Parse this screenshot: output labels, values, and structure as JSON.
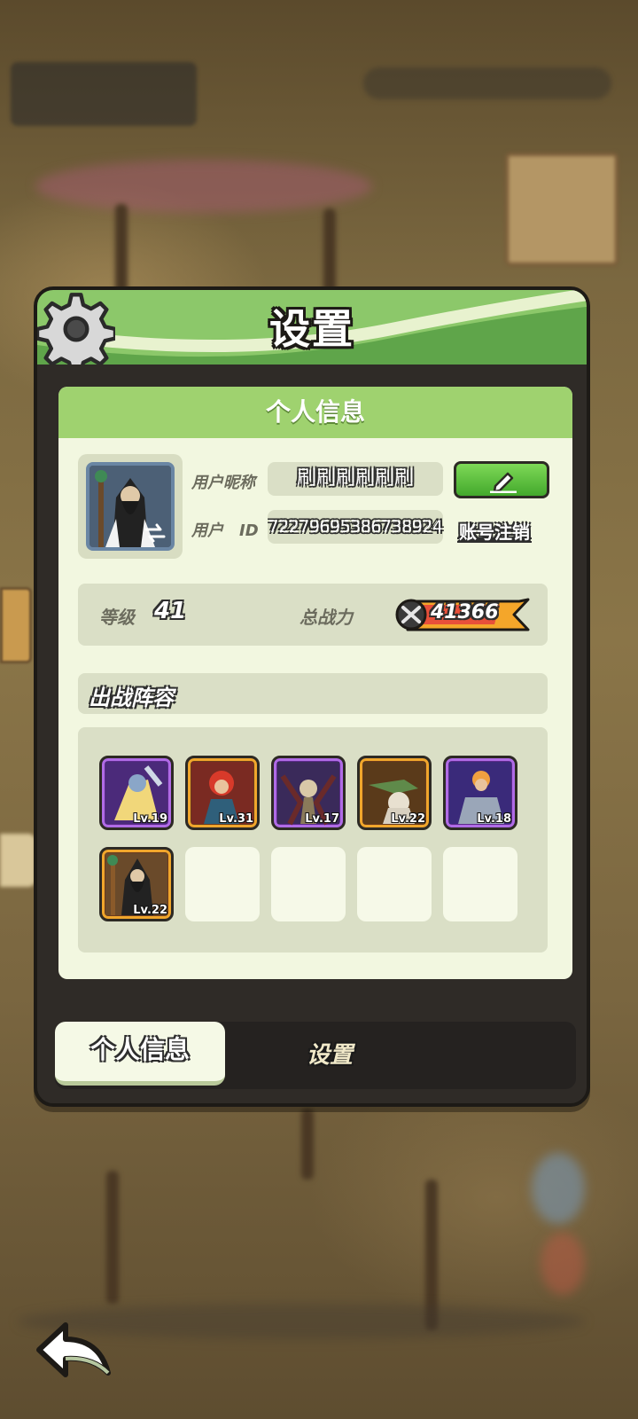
{
  "panel": {
    "title": "设置"
  },
  "profile": {
    "section_title": "个人信息",
    "nickname_label": "用户昵称",
    "nickname_value": "刷刷刷刷刷刷",
    "id_label": "用户　ID",
    "id_value": "72279695386738924",
    "deregister_label": "账号注销"
  },
  "stats": {
    "level_label": "等级",
    "level_value": "41",
    "power_label": "总战力",
    "power_value": "41366"
  },
  "lineup": {
    "title": "出战阵容",
    "heroes": [
      {
        "level": "Lv.19",
        "rarity": "purple"
      },
      {
        "level": "Lv.31",
        "rarity": "orange"
      },
      {
        "level": "Lv.17",
        "rarity": "purple"
      },
      {
        "level": "Lv.22",
        "rarity": "orange"
      },
      {
        "level": "Lv.18",
        "rarity": "purple"
      },
      {
        "level": "Lv.22",
        "rarity": "orange"
      }
    ]
  },
  "tabs": {
    "profile": "个人信息",
    "settings": "设置"
  },
  "colors": {
    "accent_green": "#9fd26f",
    "rarity_purple": "#b06be6",
    "rarity_orange": "#f0a62c"
  }
}
